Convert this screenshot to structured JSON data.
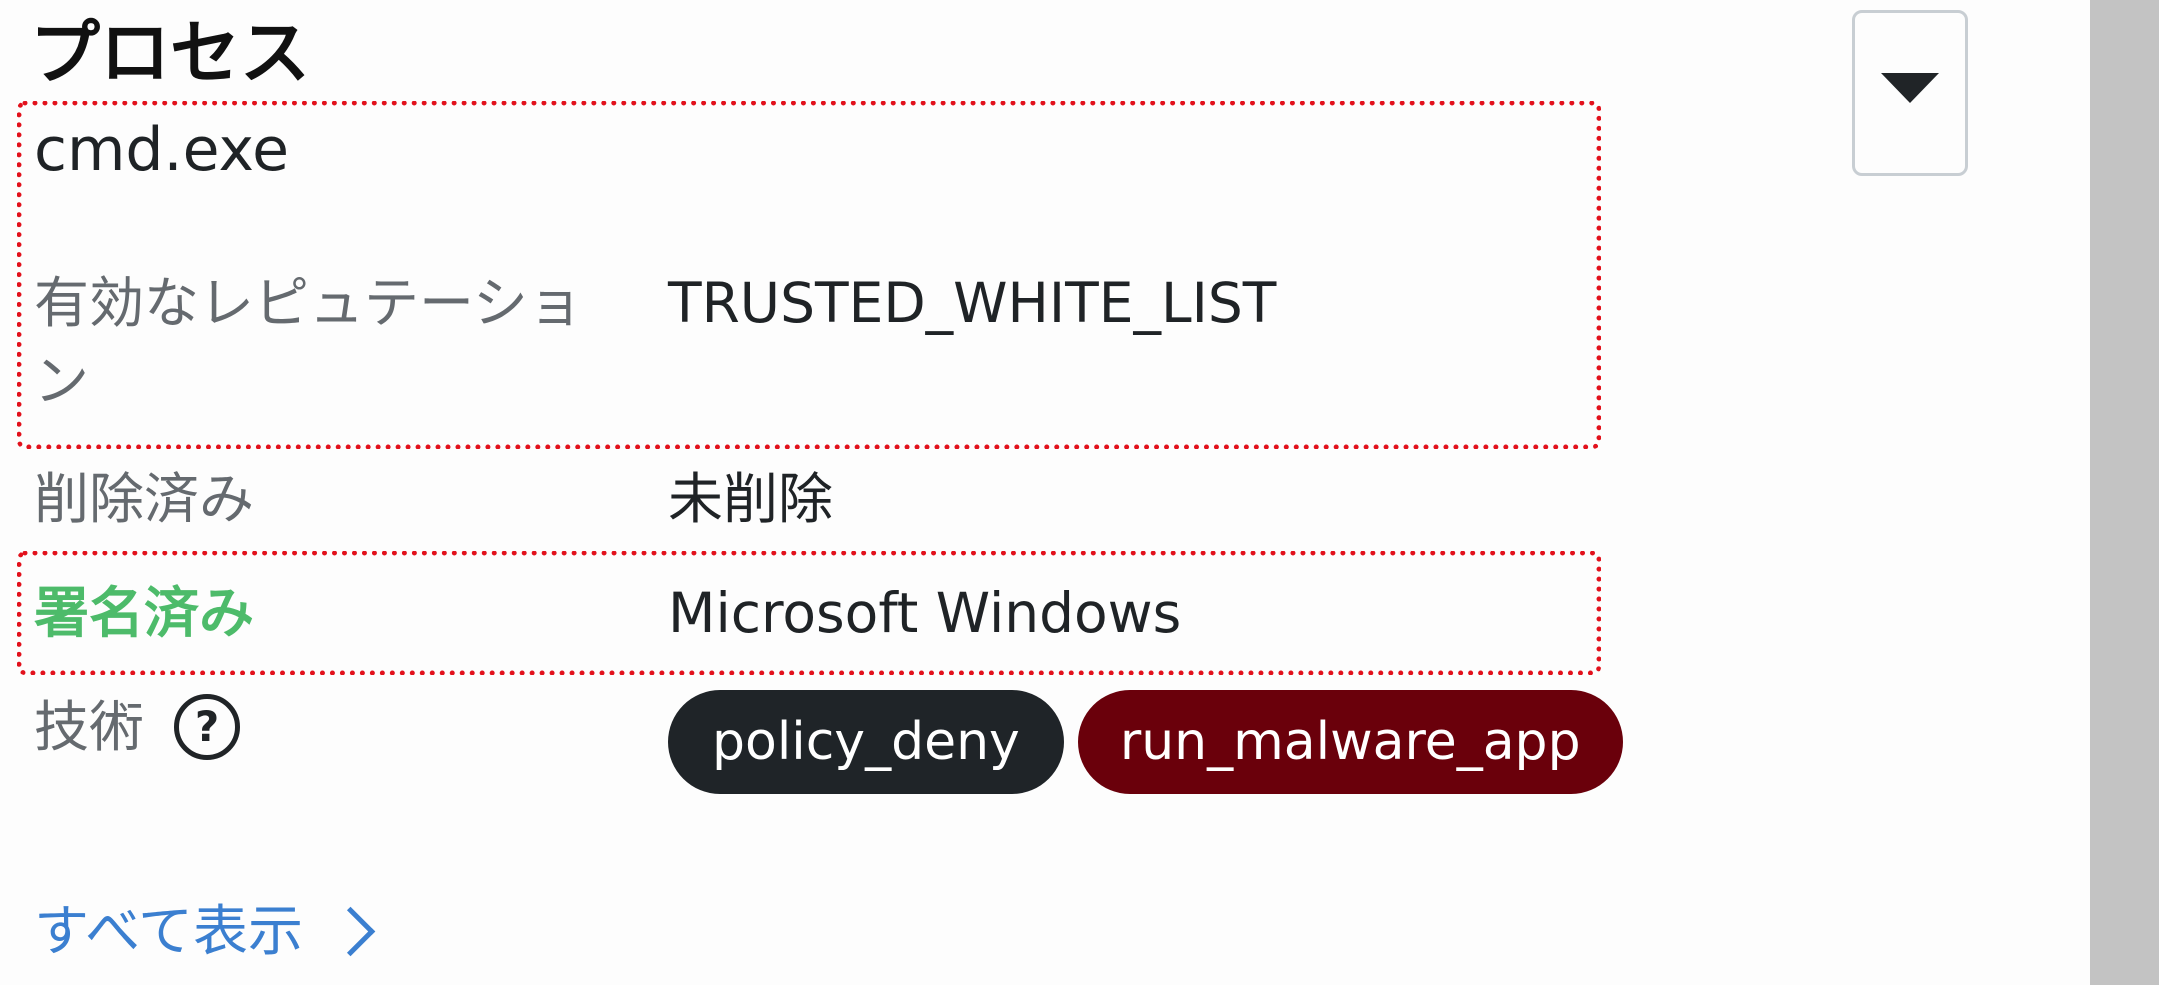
{
  "section": {
    "title": "プロセス",
    "toggle_icon": "caret-down-icon"
  },
  "process": {
    "name": "cmd.exe"
  },
  "details": {
    "reputation_label": "有効なレピュテーション",
    "reputation_value": "TRUSTED_WHITE_LIST",
    "deleted_label": "削除済み",
    "deleted_value": "未削除",
    "signed_label": "署名済み",
    "signed_value": "Microsoft Windows",
    "technique_label": "技術",
    "technique_help": "?",
    "technique_tags": [
      {
        "label": "policy_deny",
        "color": "#1f2428"
      },
      {
        "label": "run_malware_app",
        "color": "#6a000b"
      }
    ]
  },
  "footer": {
    "view_all_label": "すべて表示",
    "view_all_icon": "chevron-right-icon"
  },
  "colors": {
    "signed_label": "#4dbb6a",
    "link": "#3b7fd0",
    "highlight_border": "#e2111c"
  }
}
